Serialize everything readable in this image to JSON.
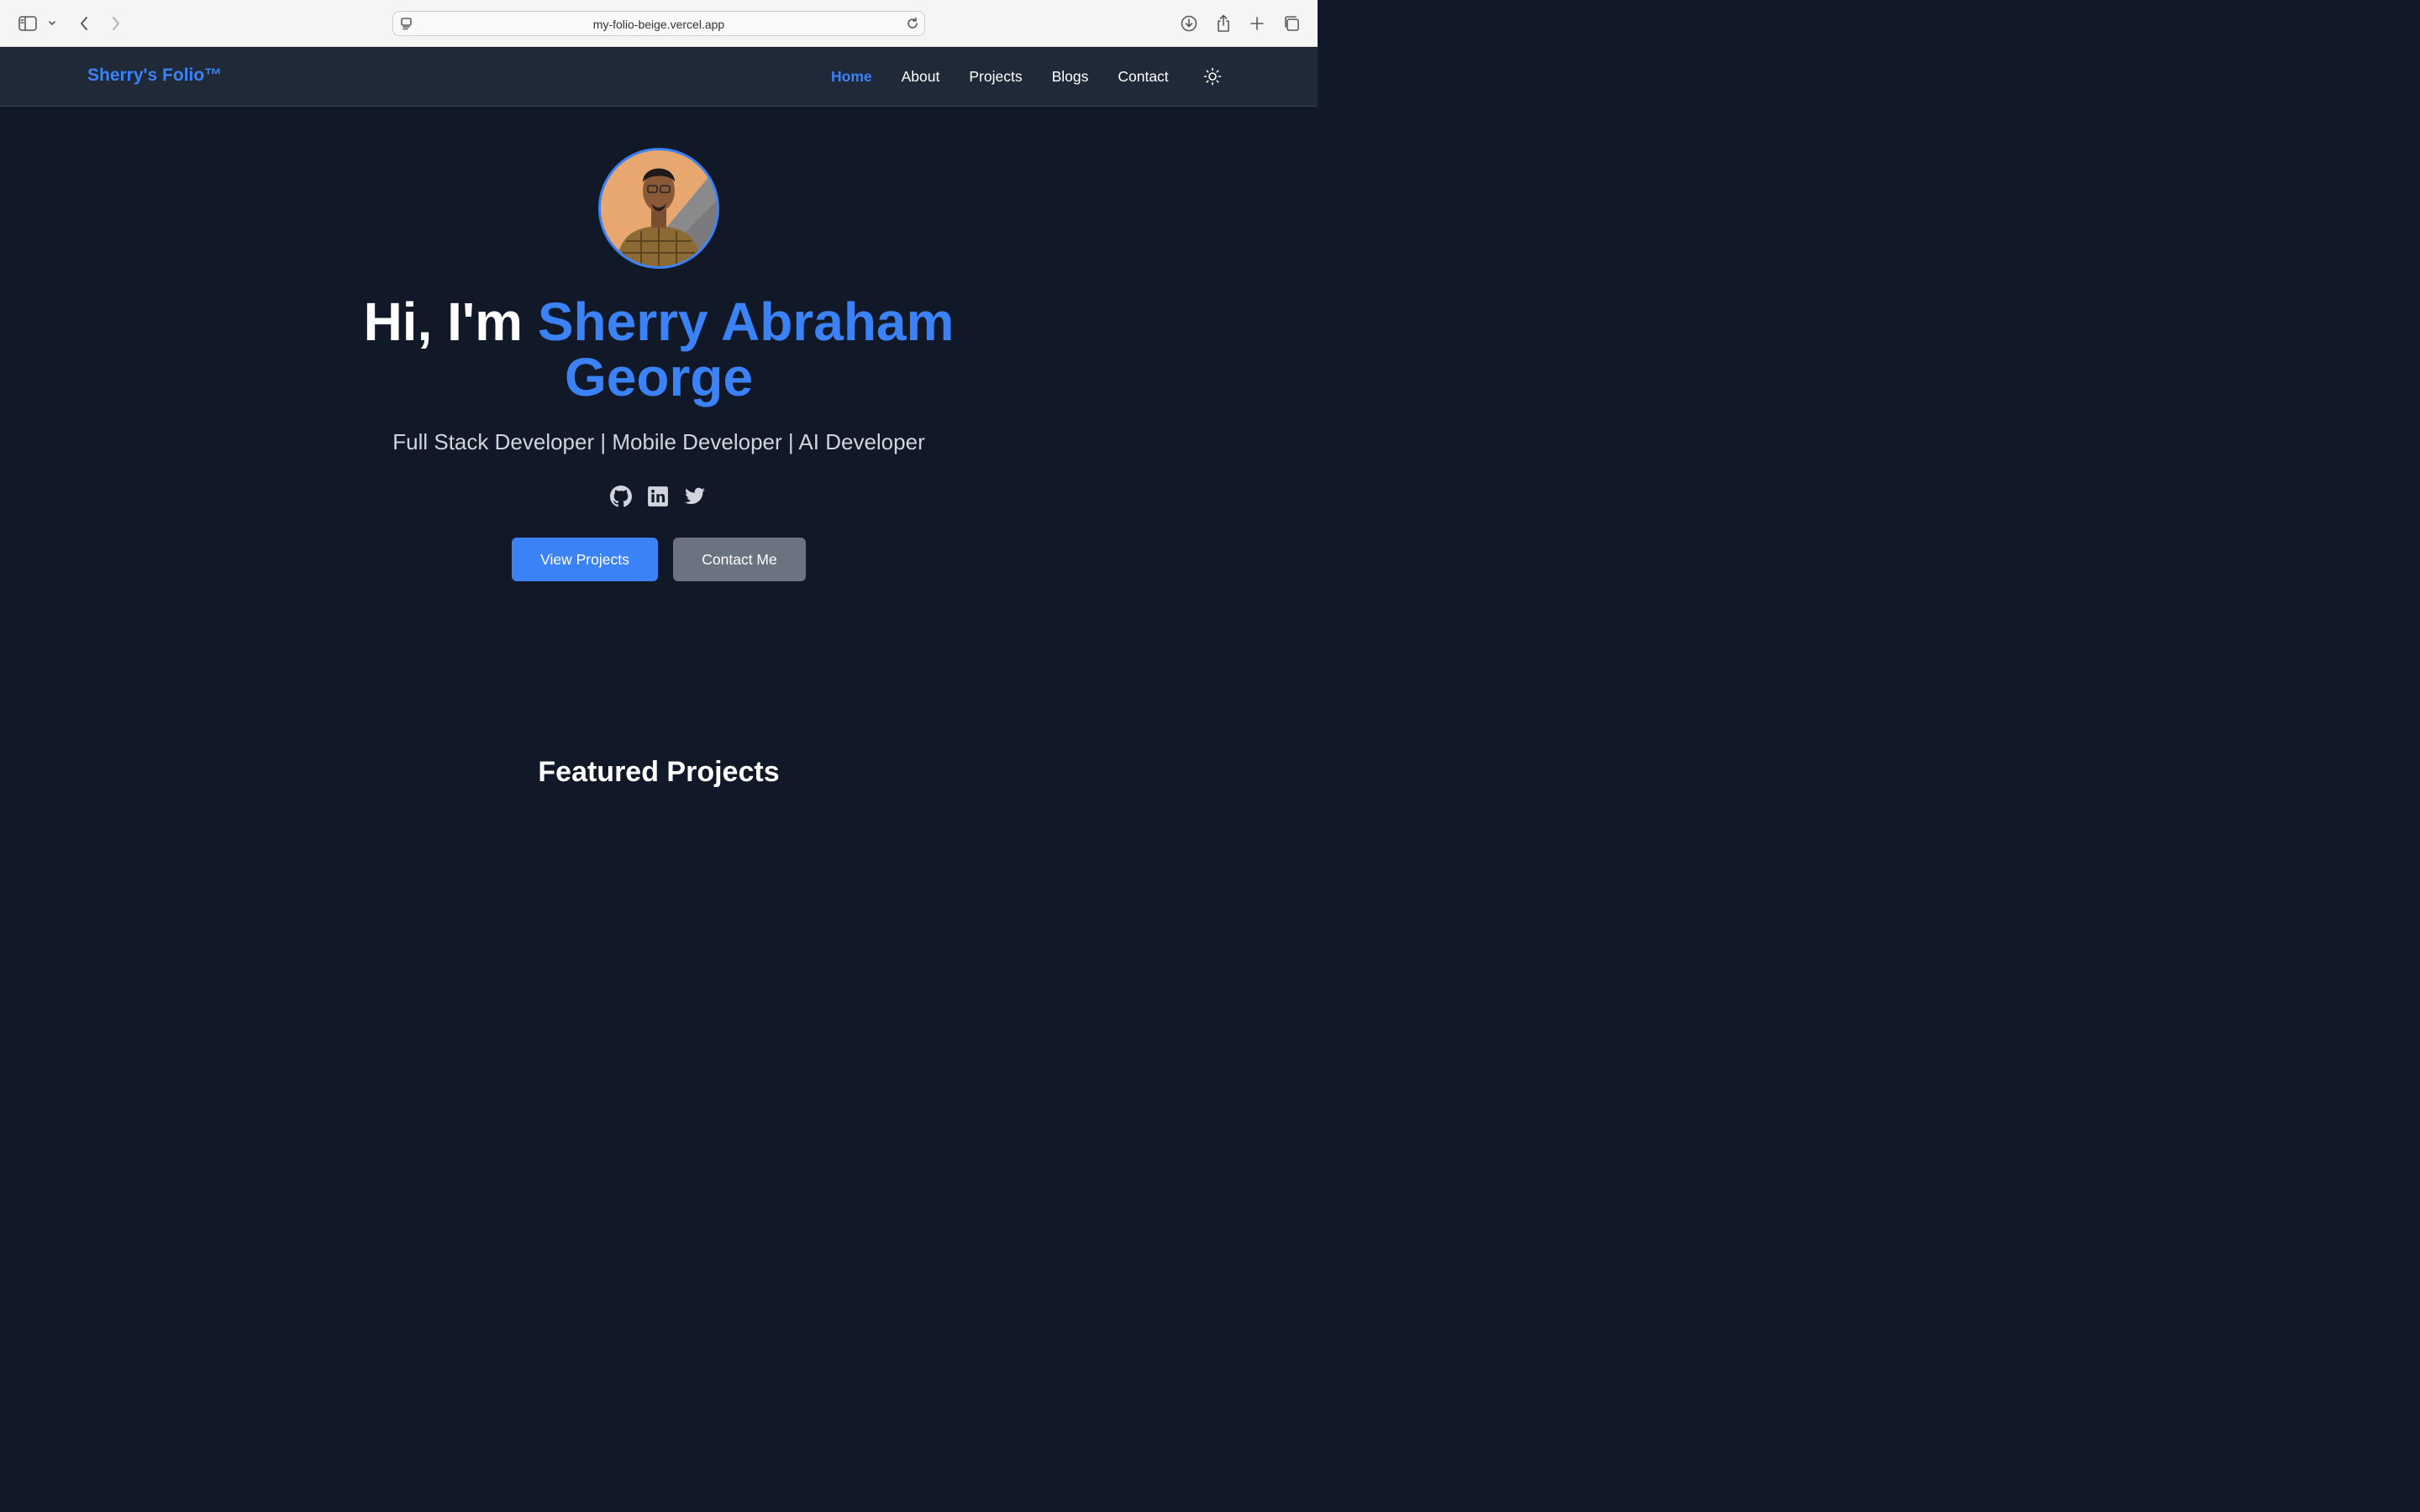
{
  "browser": {
    "url": "my-folio-beige.vercel.app",
    "icons": [
      "sidebar-icon",
      "chevron-down-icon",
      "back-icon",
      "forward-icon",
      "page-icon",
      "reload-icon",
      "download-icon",
      "share-icon",
      "new-tab-icon",
      "tabs-overview-icon"
    ]
  },
  "nav": {
    "brand": "Sherry's Folio™",
    "links": [
      {
        "label": "Home",
        "active": true
      },
      {
        "label": "About"
      },
      {
        "label": "Projects"
      },
      {
        "label": "Blogs"
      },
      {
        "label": "Contact"
      }
    ],
    "theme_icon": "sun-icon"
  },
  "hero": {
    "greeting": "Hi, I'm ",
    "name_line1": "Sherry Abraham",
    "name_line2": "George",
    "subtitle": "Full Stack Developer | Mobile Developer | AI Developer",
    "social_icons": [
      "github-icon",
      "linkedin-icon",
      "twitter-icon"
    ],
    "primary_button": "View Projects",
    "secondary_button": "Contact Me"
  },
  "sections": {
    "featured_title": "Featured Projects"
  },
  "colors": {
    "accent": "#3b82f6",
    "background": "#111827",
    "nav_background": "#1f2937",
    "secondary_button": "#6b7280"
  }
}
